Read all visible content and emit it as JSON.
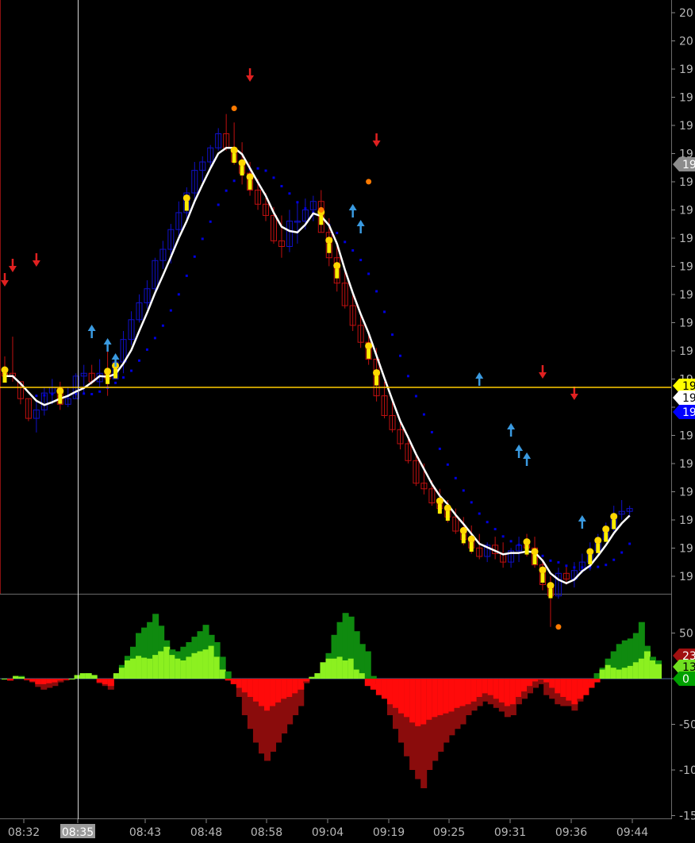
{
  "chart_data": [
    {
      "type": "candlestick",
      "panel": "price",
      "y_tick_labels": [
        "20",
        "20",
        "19",
        "19",
        "19",
        "19",
        "19",
        "19",
        "19",
        "19",
        "19",
        "19",
        "19",
        "19",
        "19",
        "19",
        "19",
        "19",
        "19",
        "19",
        "19"
      ],
      "tags": [
        {
          "label": "19",
          "color": "#8c8c8c"
        },
        {
          "label": "19",
          "color": "#ffff00"
        },
        {
          "label": "19",
          "color": "#ffffff"
        },
        {
          "label": "19",
          "color": "#0000ff"
        }
      ],
      "colors": {
        "up": "#1010c8",
        "down": "#c01010",
        "ma": "#ffffff",
        "dots": "#0000e0",
        "level_line": "#ffcc00",
        "signal": "#ffd700",
        "arrow_up": "#3a9ae0",
        "arrow_down": "#e02020"
      },
      "candles": [
        [
          0.5,
          0.3,
          1.1,
          0.4
        ],
        [
          0.5,
          0.2,
          1.8,
          0.4
        ],
        [
          0.2,
          -0.6,
          0.2,
          -0.4
        ],
        [
          -0.4,
          -1.2,
          -0.4,
          -1.1
        ],
        [
          -1.1,
          -1.6,
          -0.5,
          -0.8
        ],
        [
          -0.8,
          -1.0,
          0.0,
          -0.2
        ],
        [
          -0.2,
          -0.6,
          0.3,
          0.0
        ],
        [
          0.0,
          -0.8,
          0.2,
          -0.6
        ],
        [
          -0.6,
          -0.7,
          0.0,
          -0.4
        ],
        [
          -0.4,
          -0.4,
          0.5,
          0.4
        ],
        [
          0.4,
          -0.2,
          0.8,
          0.5
        ],
        [
          0.5,
          0.1,
          0.8,
          0.2
        ],
        [
          0.2,
          0.0,
          1.0,
          0.5
        ],
        [
          0.5,
          -0.3,
          1.4,
          0.3
        ],
        [
          0.3,
          0.3,
          1.0,
          0.9
        ],
        [
          0.9,
          0.5,
          2.0,
          1.7
        ],
        [
          1.7,
          1.5,
          2.7,
          2.4
        ],
        [
          2.4,
          2.3,
          3.3,
          3.0
        ],
        [
          3.0,
          2.8,
          3.8,
          3.5
        ],
        [
          3.5,
          3.4,
          4.6,
          4.5
        ],
        [
          4.5,
          4.2,
          5.2,
          4.9
        ],
        [
          4.9,
          4.4,
          5.8,
          5.6
        ],
        [
          5.6,
          5.2,
          6.6,
          6.2
        ],
        [
          6.2,
          5.9,
          7.1,
          6.9
        ],
        [
          6.9,
          6.5,
          8.0,
          7.7
        ],
        [
          7.7,
          7.3,
          8.2,
          8.0
        ],
        [
          8.0,
          7.8,
          8.6,
          8.5
        ],
        [
          8.5,
          8.4,
          9.2,
          9.0
        ],
        [
          9.0,
          8.4,
          9.7,
          8.5
        ],
        [
          8.5,
          7.9,
          9.4,
          8.0
        ],
        [
          8.0,
          7.2,
          8.7,
          7.6
        ],
        [
          7.6,
          6.8,
          8.0,
          7.0
        ],
        [
          7.0,
          6.3,
          7.4,
          6.5
        ],
        [
          6.5,
          5.9,
          6.9,
          6.1
        ],
        [
          6.1,
          5.1,
          6.4,
          5.2
        ],
        [
          5.2,
          4.6,
          6.1,
          5.0
        ],
        [
          5.0,
          4.8,
          6.3,
          5.9
        ],
        [
          5.9,
          5.1,
          6.6,
          5.9
        ],
        [
          5.9,
          5.6,
          6.7,
          6.3
        ],
        [
          6.3,
          5.9,
          6.8,
          6.6
        ],
        [
          6.6,
          5.5,
          7.0,
          5.5
        ],
        [
          5.5,
          4.3,
          6.0,
          4.6
        ],
        [
          4.6,
          3.4,
          5.0,
          3.7
        ],
        [
          3.7,
          2.8,
          4.1,
          2.9
        ],
        [
          2.9,
          2.0,
          3.3,
          2.2
        ],
        [
          2.2,
          1.4,
          2.6,
          1.6
        ],
        [
          1.6,
          0.8,
          2.0,
          1.0
        ],
        [
          1.0,
          -0.5,
          1.4,
          -0.3
        ],
        [
          -0.3,
          -1.1,
          0.2,
          -1.0
        ],
        [
          -1.0,
          -1.6,
          -0.5,
          -1.5
        ],
        [
          -1.5,
          -2.2,
          -1.2,
          -2.0
        ],
        [
          -2.0,
          -2.7,
          -1.7,
          -2.6
        ],
        [
          -2.6,
          -3.5,
          -2.3,
          -3.4
        ],
        [
          -3.4,
          -3.8,
          -2.7,
          -3.6
        ],
        [
          -3.6,
          -4.2,
          -3.3,
          -4.1
        ],
        [
          -4.1,
          -4.5,
          -3.6,
          -4.3
        ],
        [
          -4.3,
          -4.8,
          -4.0,
          -4.6
        ],
        [
          -4.6,
          -5.2,
          -4.3,
          -5.1
        ],
        [
          -5.1,
          -5.6,
          -4.6,
          -5.4
        ],
        [
          -5.4,
          -5.9,
          -4.9,
          -5.7
        ],
        [
          -5.7,
          -6.1,
          -5.2,
          -6.0
        ],
        [
          -6.0,
          -6.2,
          -5.5,
          -5.6
        ],
        [
          -5.6,
          -6.1,
          -5.3,
          -5.9
        ],
        [
          -5.9,
          -6.4,
          -5.5,
          -6.2
        ],
        [
          -6.2,
          -6.4,
          -5.7,
          -5.8
        ],
        [
          -5.8,
          -6.2,
          -5.3,
          -5.6
        ],
        [
          -5.6,
          -6.0,
          -5.2,
          -5.7
        ],
        [
          -5.7,
          -6.4,
          -5.3,
          -6.3
        ],
        [
          -6.3,
          -7.2,
          -6.1,
          -7.0
        ],
        [
          -7.0,
          -8.5,
          -6.7,
          -7.4
        ],
        [
          -7.4,
          -7.5,
          -6.4,
          -6.6
        ],
        [
          -6.6,
          -7.0,
          -6.3,
          -6.8
        ],
        [
          -6.8,
          -7.1,
          -6.2,
          -6.5
        ],
        [
          -6.5,
          -6.6,
          -5.9,
          -6.2
        ],
        [
          -6.2,
          -6.5,
          -5.5,
          -5.8
        ],
        [
          -5.8,
          -6.0,
          -5.2,
          -5.4
        ],
        [
          -5.4,
          -5.5,
          -4.8,
          -5.0
        ],
        [
          -5.0,
          -5.1,
          -4.2,
          -4.5
        ],
        [
          -4.5,
          -4.7,
          -4.0,
          -4.4
        ],
        [
          -4.4,
          -4.6,
          -4.2,
          -4.3
        ]
      ]
    },
    {
      "type": "bar",
      "panel": "oscillator",
      "y_tick_labels": [
        "50",
        "0",
        "-50",
        "-10",
        "-15"
      ],
      "ylim": [
        -150,
        80
      ],
      "tags": [
        {
          "label": "23",
          "color": "#a01010"
        },
        {
          "label": "13",
          "color": "#70e020"
        },
        {
          "label": "0",
          "color": "#00a000"
        }
      ],
      "colors": {
        "pos_dark": "#0f8a0f",
        "pos_light": "#8cf020",
        "neg_dark": "#8a0c0c",
        "neg_light": "#ff0a0a"
      },
      "series": [
        {
          "values": [
            0,
            -2,
            2,
            3,
            -2,
            -4,
            -9,
            -12,
            -10,
            -8,
            -4,
            -2,
            0,
            3,
            5,
            6,
            3,
            -5,
            -8,
            -12,
            4,
            15,
            25,
            35,
            50,
            56,
            62,
            71,
            58,
            42,
            32,
            30,
            35,
            40,
            46,
            52,
            59,
            48,
            40,
            24,
            8,
            -5,
            -20,
            -40,
            -55,
            -70,
            -82,
            -90,
            -80,
            -70,
            -60,
            -50,
            -40,
            -30,
            -5,
            2,
            4,
            8,
            28,
            48,
            62,
            72,
            68,
            52,
            38,
            30,
            3,
            -6,
            -20,
            -40,
            -55,
            -70,
            -85,
            -100,
            -110,
            -120,
            -100,
            -90,
            -80,
            -70,
            -62,
            -55,
            -50,
            -40,
            -35,
            -30,
            -25,
            -28,
            -32,
            -36,
            -42,
            -40,
            -28,
            -22,
            -16,
            -10,
            -6,
            -18,
            -22,
            -28,
            -30,
            -30,
            -35,
            -25,
            -10,
            -5,
            6,
            12,
            22,
            30,
            38,
            42,
            44,
            50,
            62,
            36,
            24,
            20
          ]
        },
        {
          "values": [
            0,
            -2,
            3,
            2,
            -1,
            -3,
            -6,
            -6,
            -5,
            -4,
            -2,
            -1,
            0,
            4,
            6,
            6,
            4,
            -4,
            -6,
            -8,
            6,
            12,
            20,
            22,
            25,
            23,
            22,
            26,
            30,
            35,
            26,
            22,
            20,
            24,
            28,
            30,
            32,
            36,
            24,
            10,
            -2,
            -6,
            -10,
            -15,
            -20,
            -25,
            -30,
            -35,
            -30,
            -26,
            -22,
            -20,
            -16,
            -12,
            -3,
            2,
            6,
            18,
            22,
            22,
            24,
            20,
            22,
            10,
            6,
            -8,
            -12,
            -18,
            -22,
            -28,
            -32,
            -38,
            -42,
            -48,
            -52,
            -50,
            -45,
            -42,
            -40,
            -38,
            -36,
            -32,
            -30,
            -28,
            -25,
            -20,
            -16,
            -18,
            -22,
            -26,
            -30,
            -28,
            -20,
            -14,
            -8,
            -3,
            -1,
            -4,
            -10,
            -16,
            -20,
            -24,
            -28,
            -22,
            -18,
            -10,
            -4,
            10,
            15,
            12,
            10,
            12,
            14,
            18,
            22,
            30,
            20,
            16
          ]
        }
      ]
    },
    {
      "type": "time_axis",
      "x_tick_labels": [
        "08:32",
        "08:35",
        "08:43",
        "08:48",
        "08:58",
        "09:04",
        "09:19",
        "09:25",
        "09:31",
        "09:36",
        "09:44"
      ],
      "cursor_label": "08:35"
    }
  ]
}
